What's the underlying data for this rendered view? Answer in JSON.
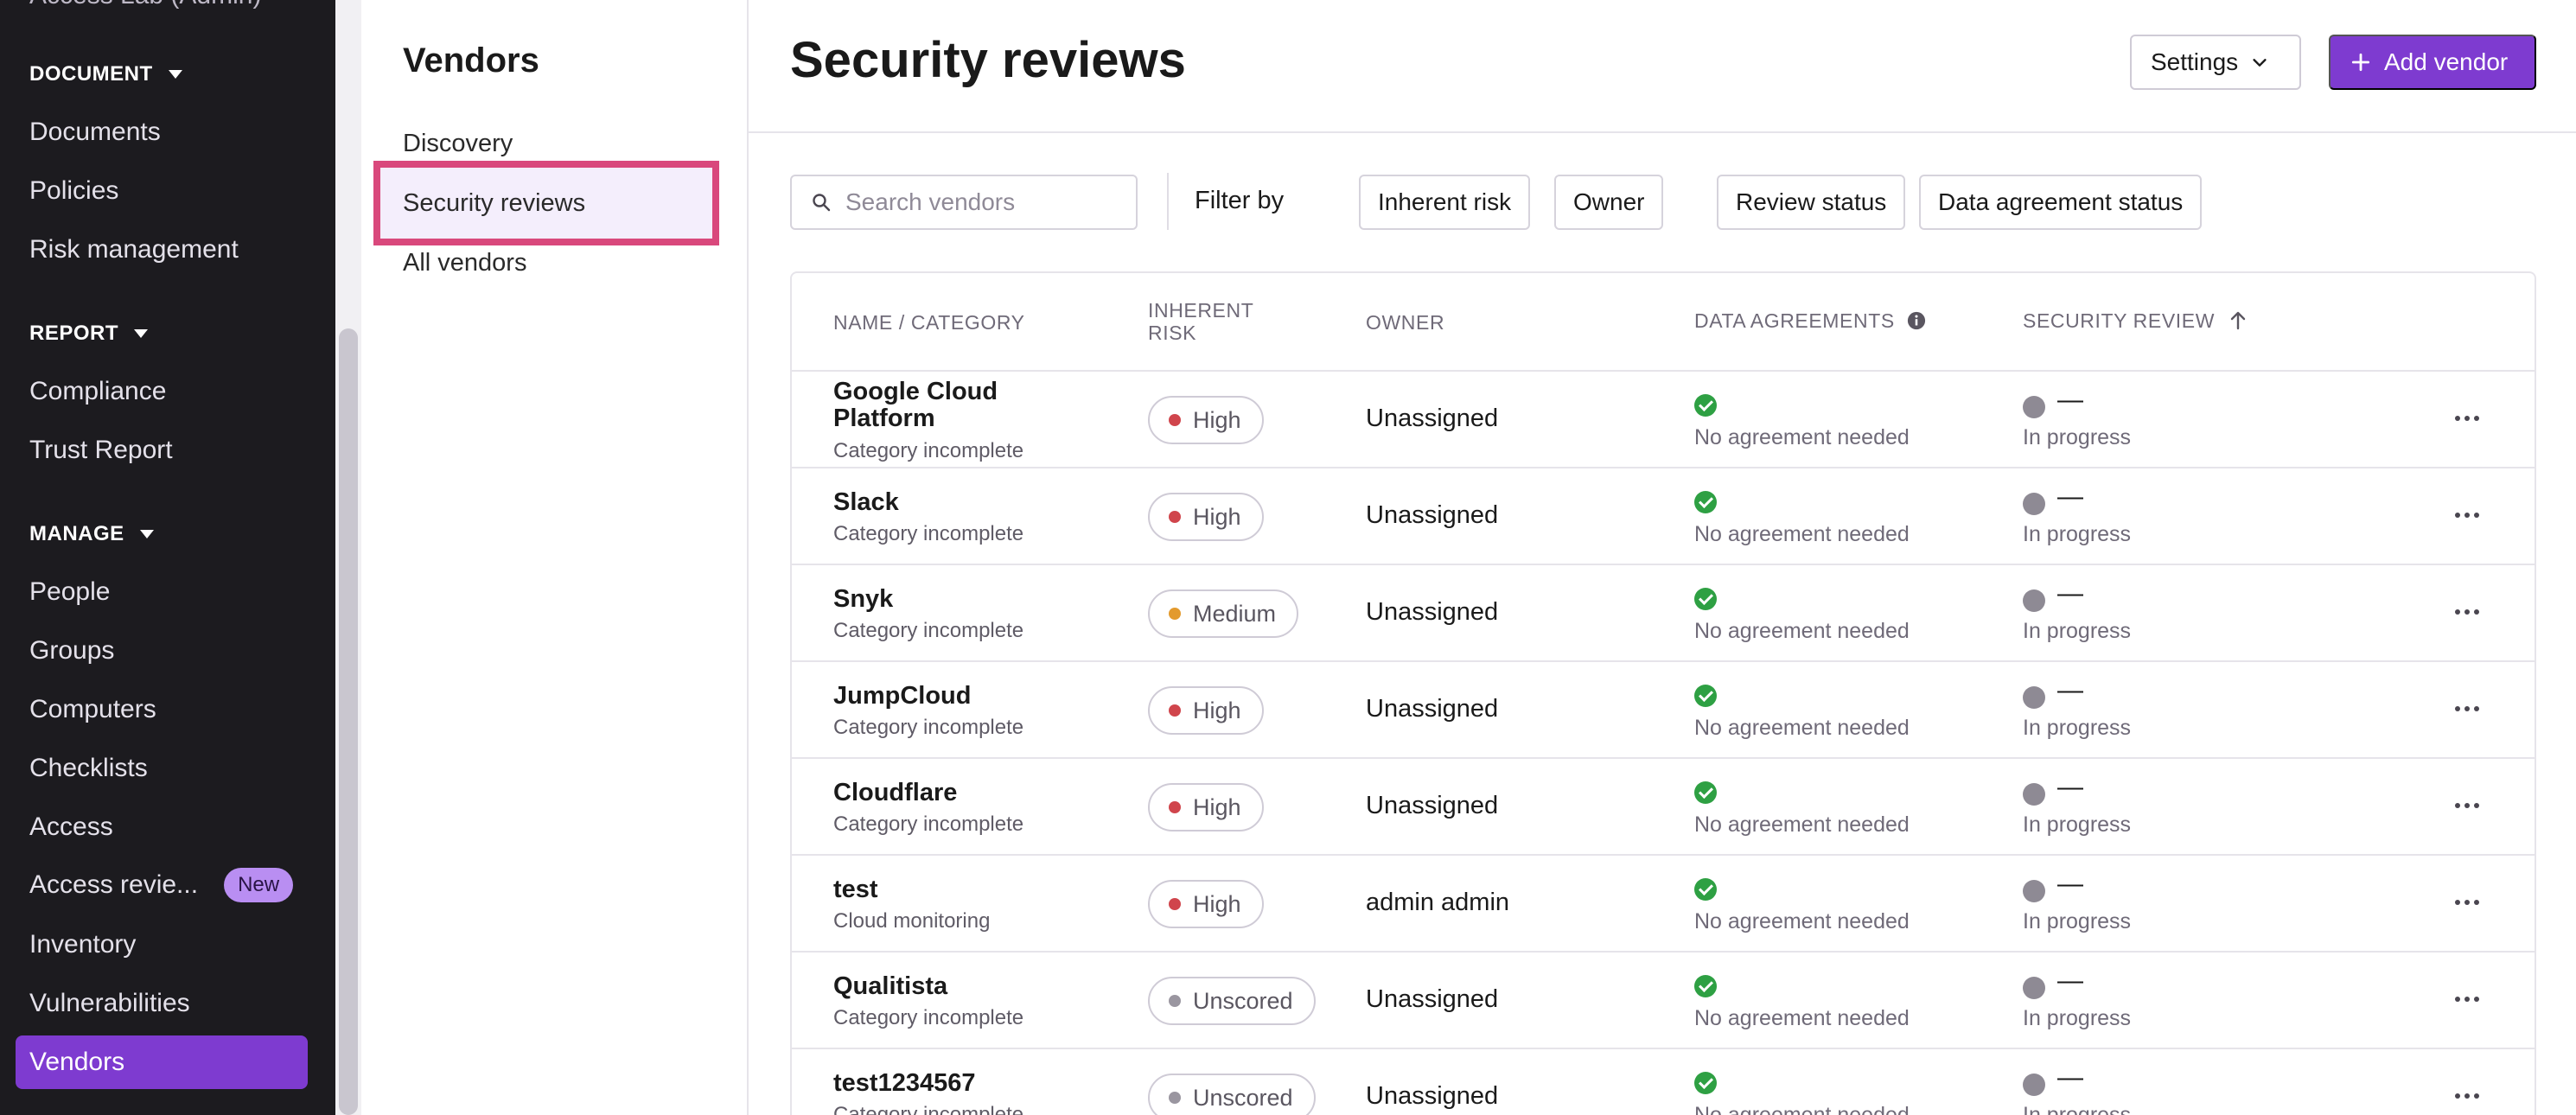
{
  "sidebar": {
    "cut_item": "Access Lab (Admin)",
    "sections": [
      {
        "label": "DOCUMENT",
        "items": [
          "Documents",
          "Policies",
          "Risk management"
        ]
      },
      {
        "label": "REPORT",
        "items": [
          "Compliance",
          "Trust Report"
        ]
      },
      {
        "label": "MANAGE",
        "items": [
          "People",
          "Groups",
          "Computers",
          "Checklists",
          "Access",
          "Access revie...",
          "Inventory",
          "Vulnerabilities",
          "Vendors"
        ]
      }
    ],
    "new_badge": "New",
    "active_item": "Vendors"
  },
  "subnav": {
    "title": "Vendors",
    "items": [
      "Discovery",
      "Security reviews",
      "All vendors"
    ],
    "selected": "Security reviews"
  },
  "header": {
    "title": "Security reviews",
    "settings_label": "Settings",
    "add_vendor_label": "Add vendor"
  },
  "toolbar": {
    "search_placeholder": "Search vendors",
    "filter_label": "Filter by",
    "filters": [
      "Inherent risk",
      "Owner",
      "Review status",
      "Data agreement status"
    ]
  },
  "table": {
    "headers": {
      "name": "NAME / CATEGORY",
      "risk": "INHERENT RISK",
      "owner": "OWNER",
      "agreements": "DATA AGREEMENTS",
      "review": "SECURITY REVIEW"
    },
    "rows": [
      {
        "name": "Google Cloud Platform",
        "category": "Category incomplete",
        "risk": "High",
        "owner": "Unassigned",
        "agreement": "No agreement needed",
        "review_value": "—",
        "review_status": "In progress"
      },
      {
        "name": "Slack",
        "category": "Category incomplete",
        "risk": "High",
        "owner": "Unassigned",
        "agreement": "No agreement needed",
        "review_value": "—",
        "review_status": "In progress"
      },
      {
        "name": "Snyk",
        "category": "Category incomplete",
        "risk": "Medium",
        "owner": "Unassigned",
        "agreement": "No agreement needed",
        "review_value": "—",
        "review_status": "In progress"
      },
      {
        "name": "JumpCloud",
        "category": "Category incomplete",
        "risk": "High",
        "owner": "Unassigned",
        "agreement": "No agreement needed",
        "review_value": "—",
        "review_status": "In progress"
      },
      {
        "name": "Cloudflare",
        "category": "Category incomplete",
        "risk": "High",
        "owner": "Unassigned",
        "agreement": "No agreement needed",
        "review_value": "—",
        "review_status": "In progress"
      },
      {
        "name": "test",
        "category": "Cloud monitoring",
        "risk": "High",
        "owner": "admin admin",
        "agreement": "No agreement needed",
        "review_value": "—",
        "review_status": "In progress"
      },
      {
        "name": "Qualitista",
        "category": "Category incomplete",
        "risk": "Unscored",
        "owner": "Unassigned",
        "agreement": "No agreement needed",
        "review_value": "—",
        "review_status": "In progress"
      },
      {
        "name": "test1234567",
        "category": "Category incomplete",
        "risk": "Unscored",
        "owner": "Unassigned",
        "agreement": "No agreement needed",
        "review_value": "—",
        "review_status": "In progress"
      }
    ]
  },
  "colors": {
    "accent": "#7e3bd0",
    "risk_high": "#d0454c",
    "risk_medium": "#e39a2d",
    "risk_unscored": "#9a96a0",
    "agreement_ok": "#2ea043",
    "highlight_border": "#d9487c"
  },
  "icons": {
    "search": "search-icon",
    "settings_caret": "chevron-down-icon",
    "add": "plus-icon",
    "info": "info-icon",
    "sort": "arrow-up-icon",
    "row_menu": "more-horizontal-icon"
  }
}
